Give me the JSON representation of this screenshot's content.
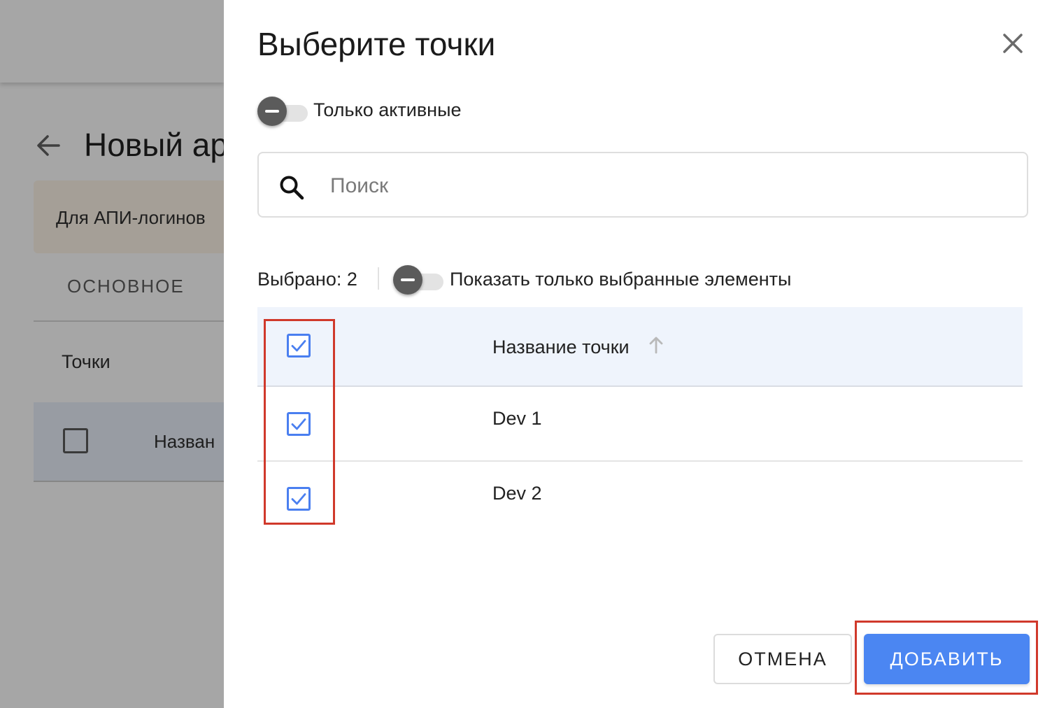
{
  "background_page": {
    "title": "Новый ар",
    "banner_text": "Для АПИ-логинов",
    "tab_label": "ОСНОВНОЕ",
    "section_title": "Точки",
    "table_header_label": "Назван"
  },
  "dialog": {
    "title": "Выберите точки",
    "only_active_label": "Только активные",
    "search": {
      "placeholder": "Поиск",
      "value": ""
    },
    "selected_count_text": "Выбрано: 2",
    "show_selected_only_label": "Показать только выбранные элементы",
    "table": {
      "column_header": "Название точки",
      "header_checked": true,
      "rows": [
        {
          "name": "Dev 1",
          "checked": true
        },
        {
          "name": "Dev 2",
          "checked": true
        }
      ]
    },
    "cancel_label": "ОТМЕНА",
    "add_label": "ДОБАВИТЬ"
  },
  "colors": {
    "accent": "#4b86f2",
    "header_bg": "#eff4fc",
    "highlight": "#d0392b",
    "overlay": "#a6a6a6"
  }
}
